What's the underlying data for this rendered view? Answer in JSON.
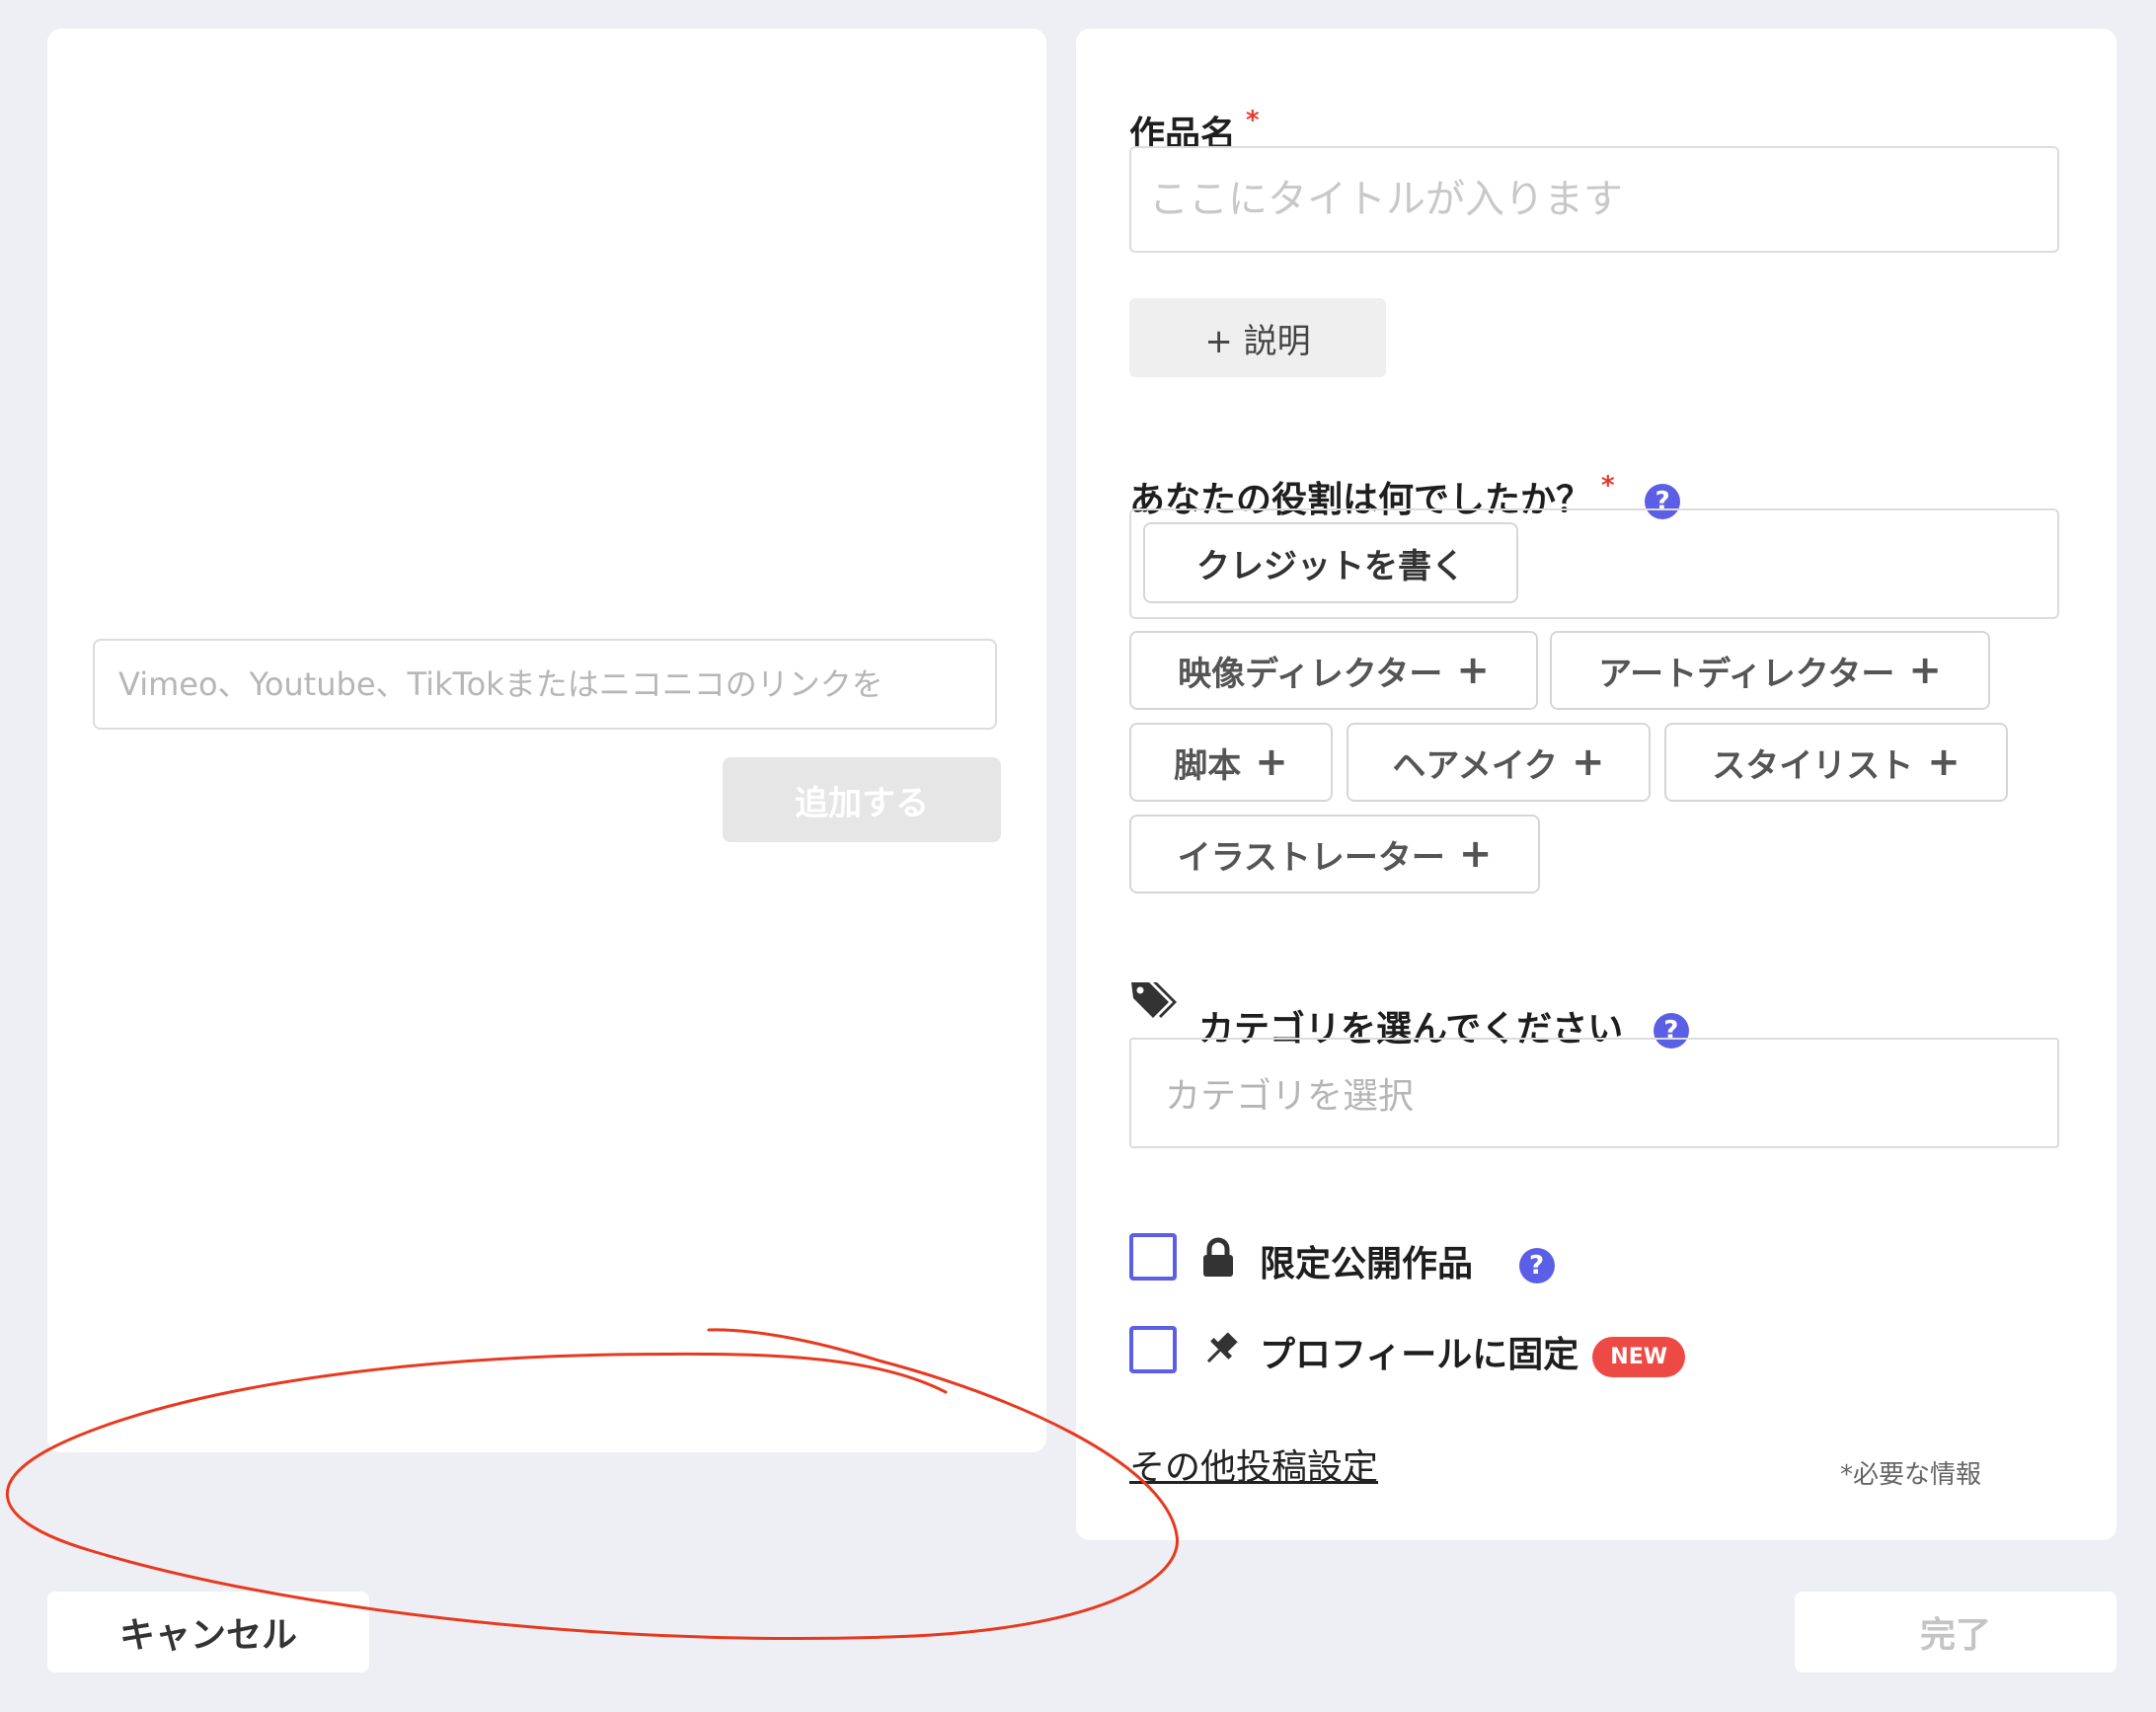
{
  "media": {
    "link_placeholder": "Vimeo、Youtube、TikTokまたはニコニコのリンクを",
    "add_label": "追加する"
  },
  "form": {
    "title_label": "作品名",
    "title_placeholder": "ここにタイトルが入ります",
    "required_mark": "*",
    "description_button": "+ 説明",
    "role_question": "あなたの役割は何でしたか？",
    "help_mark": "?",
    "credit_button": "クレジットを書く",
    "roles": [
      {
        "label": "映像ディレクター"
      },
      {
        "label": "アートディレクター"
      },
      {
        "label": "脚本"
      },
      {
        "label": "ヘアメイク"
      },
      {
        "label": "スタイリスト"
      },
      {
        "label": "イラストレーター"
      }
    ],
    "plus_glyph": "+",
    "category_label": "カテゴリを選んでください",
    "category_placeholder": "カテゴリを選択",
    "limited_label": "限定公開作品",
    "pin_label": "プロフィールに固定",
    "new_badge": "NEW",
    "other_settings": "その他投稿設定",
    "required_note": "*必要な情報"
  },
  "footer": {
    "cancel": "キャンセル",
    "done": "完了"
  },
  "colors": {
    "accent": "#5b5fe6",
    "required": "#e53b2c",
    "badge": "#ee4a45",
    "annotation": "#e8391f"
  },
  "icons": {
    "tag": "tag-icon",
    "lock": "lock-icon",
    "pin": "pin-icon",
    "help": "help-icon"
  }
}
